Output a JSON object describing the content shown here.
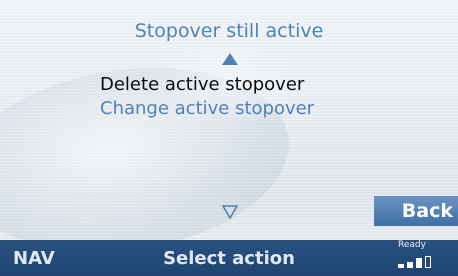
{
  "header": {
    "title": "Stopover still active"
  },
  "menu": {
    "items": [
      {
        "label": "Delete active stopover",
        "selected": true
      },
      {
        "label": "Change active stopover",
        "selected": false
      }
    ]
  },
  "buttons": {
    "back_label": "Back"
  },
  "status": {
    "mode": "NAV",
    "prompt": "Select action",
    "ready_label": "Ready",
    "signal_bars_filled": 3,
    "signal_bars_total": 4
  },
  "colors": {
    "accent": "#4f83b8",
    "status_bar": "#24497a",
    "selected_text": "#0d0d0d"
  },
  "icons": {
    "scroll_up": "triangle-up-icon",
    "scroll_down": "triangle-down-icon",
    "signal": "signal-strength-icon"
  }
}
